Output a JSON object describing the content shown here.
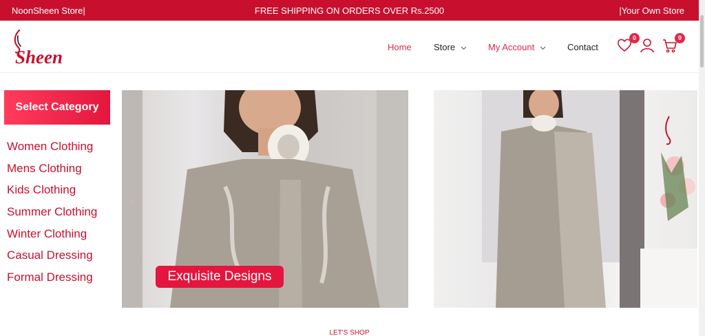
{
  "topbar": {
    "left": "NoonSheen Store|",
    "center": "FREE SHIPPING ON ORDERS OVER Rs.2500",
    "right": "|Your Own Store"
  },
  "header": {
    "logo_text": "Sheen",
    "nav": {
      "home": "Home",
      "store": "Store",
      "account": "My Account",
      "contact": "Contact"
    },
    "wishlist_count": "0",
    "cart_count": "0"
  },
  "sidebar": {
    "heading": "Select Category",
    "items": [
      "Women Clothing",
      "Mens Clothing",
      "Kids Clothing",
      "Summer Clothing",
      "Winter Clothing",
      "Casual Dressing",
      "Formal Dressing"
    ]
  },
  "slider": {
    "caption": "Exquisite Designs"
  },
  "section": {
    "lets_shop": "LET'S SHOP"
  },
  "colors": {
    "brand": "#c8102e",
    "accent": "#e0284a"
  }
}
